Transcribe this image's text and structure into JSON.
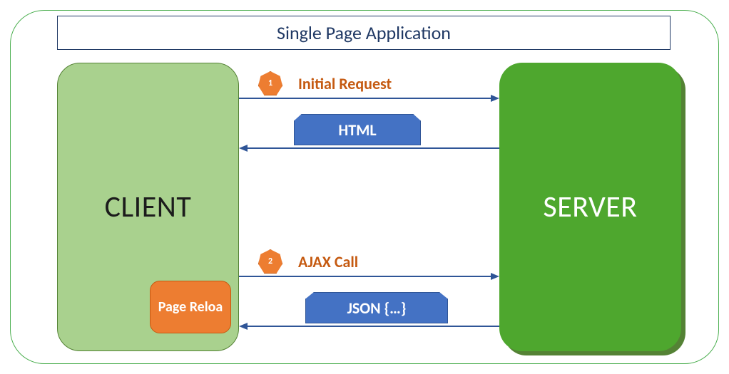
{
  "title": "Single Page Application",
  "client": {
    "label": "CLIENT"
  },
  "server": {
    "label": "SERVER"
  },
  "page_reload": {
    "label": "Page Reloa"
  },
  "steps": {
    "step1": {
      "num": "1",
      "label": "Initial Request"
    },
    "step2": {
      "num": "2",
      "label": "AJAX Call"
    }
  },
  "chips": {
    "html": "HTML",
    "json": "JSON {…}"
  },
  "chart_data": {
    "type": "sequence-diagram",
    "title": "Single Page Application",
    "participants": [
      "CLIENT",
      "SERVER"
    ],
    "messages": [
      {
        "step": 1,
        "from": "CLIENT",
        "to": "SERVER",
        "label": "Initial Request"
      },
      {
        "step": 1,
        "from": "SERVER",
        "to": "CLIENT",
        "label": "HTML"
      },
      {
        "step": 2,
        "from": "CLIENT",
        "to": "SERVER",
        "label": "AJAX Call"
      },
      {
        "step": 2,
        "from": "SERVER",
        "to": "CLIENT",
        "label": "JSON {…}"
      }
    ],
    "notes": [
      {
        "on": "CLIENT",
        "label": "Page Reloa"
      }
    ]
  }
}
